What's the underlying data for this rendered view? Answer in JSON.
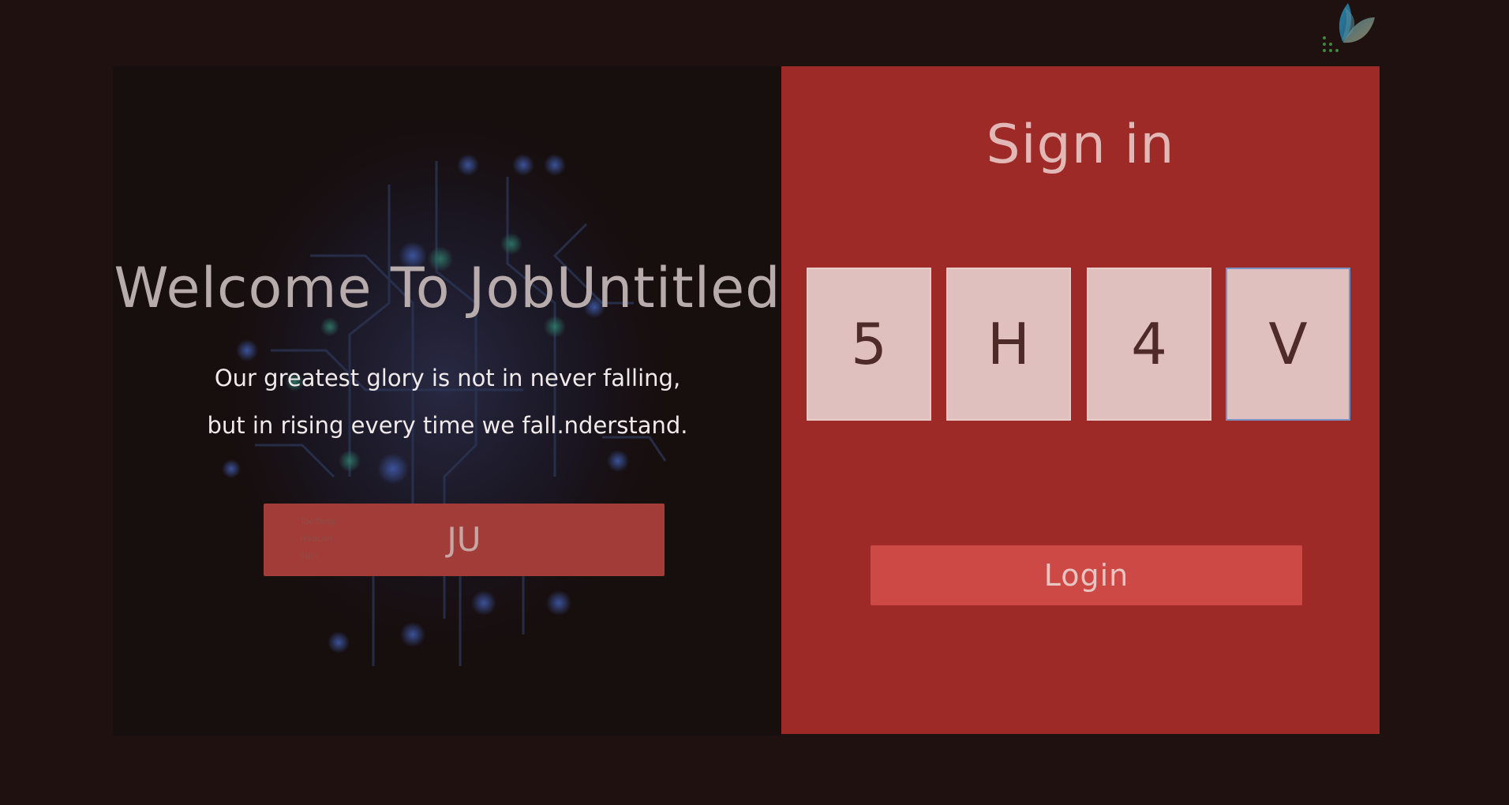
{
  "left": {
    "title": "Welcome To JobUntitled",
    "quote_line1": "Our greatest glory is not in never falling,",
    "quote_line2": "but in rising every time we fall.nderstand.",
    "ju_button": {
      "label": "JU",
      "tags": [
        "TaoYang",
        "HaoLeh",
        "Sijin"
      ]
    }
  },
  "signin": {
    "title": "Sign in",
    "code": [
      "5",
      "H",
      "4",
      "V"
    ],
    "focused_index": 3,
    "login_label": "Login"
  },
  "colors": {
    "page_bg": "#1e110f",
    "panel_left_bg": "#170e0e",
    "panel_right_bg": "#9d2a27",
    "code_box_bg": "#e0c0be",
    "login_button_bg": "#cd4945",
    "ju_button_bg": "#a23c39",
    "focus_border": "#7d90c2"
  },
  "icons": {
    "logo": "leaf-logo-icon"
  }
}
